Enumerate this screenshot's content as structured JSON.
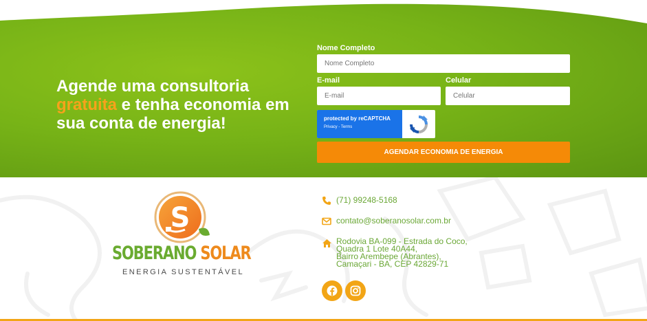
{
  "hero": {
    "headline_part1": "Agende uma consultoria",
    "headline_accent": "gratuita",
    "headline_part2": " e tenha economia em sua conta de energia!"
  },
  "form": {
    "name_label": "Nome Completo",
    "name_placeholder": "Nome Completo",
    "email_label": "E-mail",
    "email_placeholder": "E-mail",
    "phone_label": "Celular",
    "phone_placeholder": "Celular",
    "captcha_text": "protected by reCAPTCHA",
    "captcha_links": "Privacy - Terms",
    "submit_label": "AGENDAR ECONOMIA DE ENERGIA"
  },
  "brand": {
    "name_part1": "SOBERANO",
    "name_part2": "SOLAR",
    "tagline": "ENERGIA SUSTENTÁVEL",
    "logo_letter": "S"
  },
  "contact": {
    "phone": "(71) 99248-5168",
    "email": "contato@soberanosolar.com.br",
    "address_line1": "Rodovia BA-099 - Estrada do Coco,",
    "address_line2": "Quadra 1 Lote 40A44,",
    "address_line3": "Bairro Arembepe (Abrantes),",
    "address_line4": "Camaçari - BA, CEP 42829-71"
  },
  "social": {
    "icons": [
      "facebook-icon",
      "instagram-icon"
    ]
  },
  "colors": {
    "green": "#77b317",
    "orange": "#f58a07",
    "text_green": "#6aa735",
    "gold": "#f2a516"
  }
}
